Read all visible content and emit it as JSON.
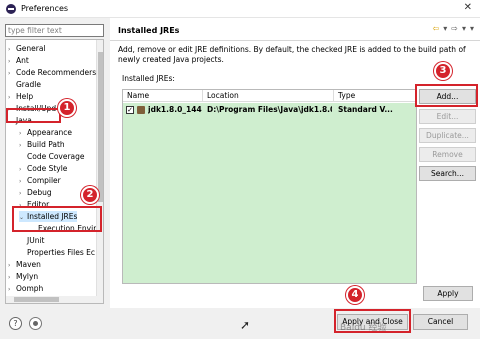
{
  "window": {
    "title": "Preferences",
    "close_glyph": "✕"
  },
  "filter": {
    "placeholder": "type filter text"
  },
  "tree": [
    {
      "label": "General",
      "arrow": "›",
      "indent": 0
    },
    {
      "label": "Ant",
      "arrow": "›",
      "indent": 0
    },
    {
      "label": "Code Recommenders",
      "arrow": "›",
      "indent": 0
    },
    {
      "label": "Gradle",
      "arrow": "",
      "indent": 0
    },
    {
      "label": "Help",
      "arrow": "›",
      "indent": 0
    },
    {
      "label": "Install/Upd",
      "arrow": "›",
      "indent": 0
    },
    {
      "label": "Java",
      "arrow": "⌄",
      "indent": 0
    },
    {
      "label": "Appearance",
      "arrow": "›",
      "indent": 1
    },
    {
      "label": "Build Path",
      "arrow": "›",
      "indent": 1
    },
    {
      "label": "Code Coverage",
      "arrow": "",
      "indent": 1
    },
    {
      "label": "Code Style",
      "arrow": "›",
      "indent": 1
    },
    {
      "label": "Compiler",
      "arrow": "›",
      "indent": 1
    },
    {
      "label": "Debug",
      "arrow": "›",
      "indent": 1
    },
    {
      "label": "Editor",
      "arrow": "›",
      "indent": 1
    },
    {
      "label": "Installed JREs",
      "arrow": "⌄",
      "indent": 1,
      "selected": true
    },
    {
      "label": "Execution Envir",
      "arrow": "",
      "indent": 2
    },
    {
      "label": "JUnit",
      "arrow": "",
      "indent": 1
    },
    {
      "label": "Properties Files Ec",
      "arrow": "",
      "indent": 1
    },
    {
      "label": "Maven",
      "arrow": "›",
      "indent": 0
    },
    {
      "label": "Mylyn",
      "arrow": "›",
      "indent": 0
    },
    {
      "label": "Oomph",
      "arrow": "›",
      "indent": 0
    }
  ],
  "page": {
    "title": "Installed JREs",
    "description": "Add, remove or edit JRE definitions. By default, the checked JRE is added to the build path of newly created Java projects.",
    "list_label": "Installed JREs:",
    "nav_back": "⇦",
    "nav_back_menu": "▾",
    "nav_forward": "⇨",
    "nav_forward_menu": "▾",
    "nav_menu": "▾"
  },
  "table": {
    "columns": [
      "Name",
      "Location",
      "Type"
    ],
    "rows": [
      {
        "checked": true,
        "check_glyph": "✓",
        "name": "jdk1.8.0_144 ...",
        "location": "D:\\Program Files\\Java\\jdk1.8.0_...",
        "type": "Standard V..."
      }
    ]
  },
  "buttons": {
    "add": "Add...",
    "edit": "Edit...",
    "duplicate": "Duplicate...",
    "remove": "Remove",
    "search": "Search...",
    "apply": "Apply",
    "apply_close": "Apply and Close",
    "cancel": "Cancel"
  },
  "bottom": {
    "help_glyph": "?"
  },
  "annotations": {
    "badge_1": "1",
    "badge_2": "2",
    "badge_3": "3",
    "badge_4": "4",
    "color": "#d4232b"
  },
  "watermark": "Baidu 经验"
}
